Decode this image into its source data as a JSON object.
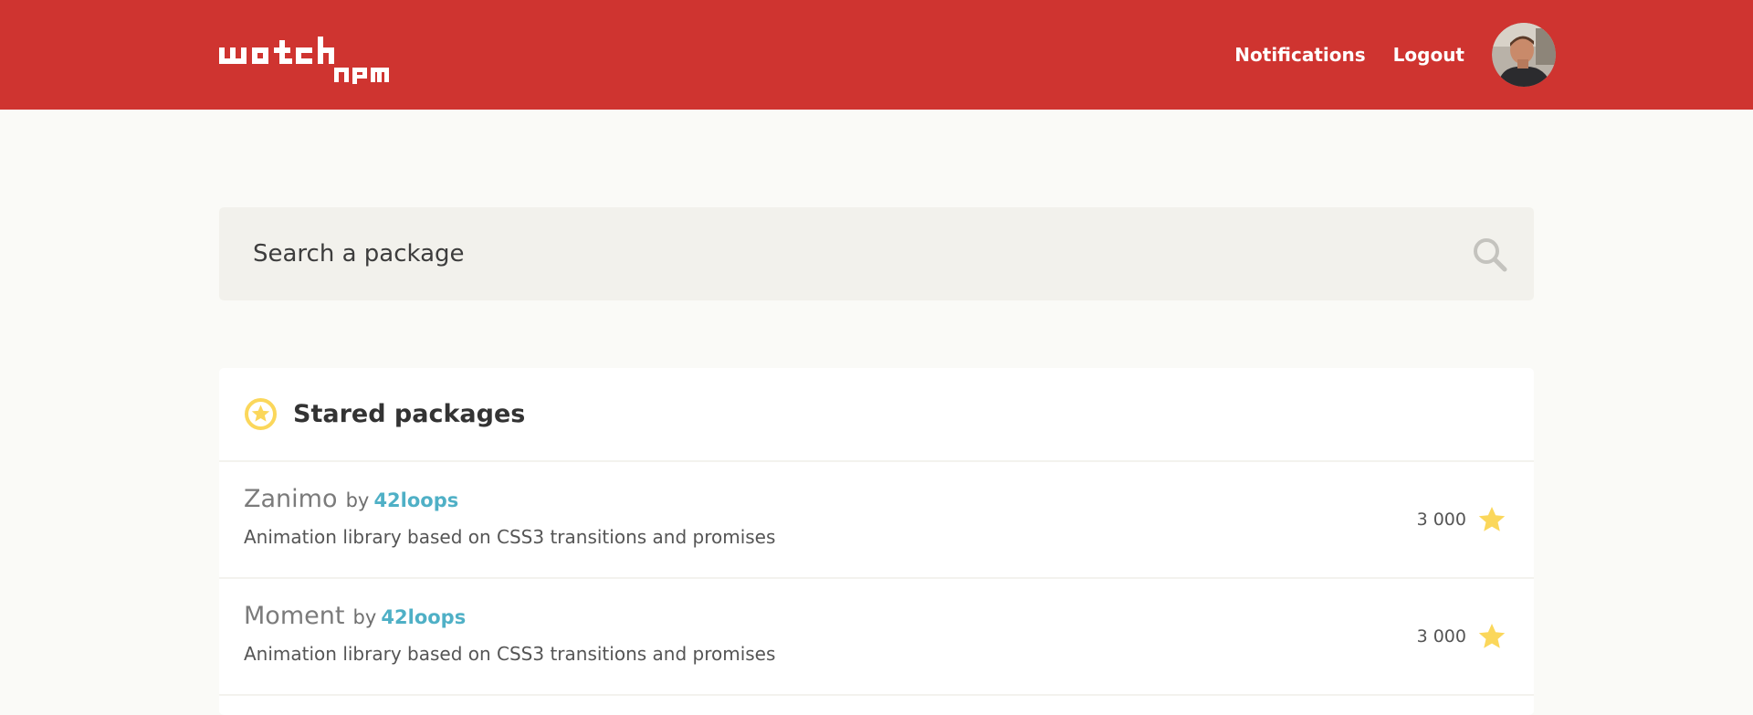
{
  "header": {
    "logo_icon": "watch-npm-logo",
    "nav": {
      "notifications_label": "Notifications",
      "logout_label": "Logout"
    },
    "avatar_icon": "user-avatar"
  },
  "search": {
    "placeholder": "Search a package",
    "icon": "search-icon"
  },
  "stared": {
    "title": "Stared packages",
    "icon": "star-badge-icon",
    "packages": [
      {
        "name": "Zanimo",
        "by": "by",
        "author": "42loops",
        "description": "Animation library based on CSS3 transitions and promises",
        "stars": "3 000"
      },
      {
        "name": "Moment",
        "by": "by",
        "author": "42loops",
        "description": "Animation library based on CSS3 transitions and promises",
        "stars": "3 000"
      }
    ]
  },
  "colors": {
    "header_bg": "#cf3430",
    "page_bg": "#fafaf7",
    "search_bg": "#f2f1ec",
    "accent_link": "#4fb0c6",
    "star": "#fbd75b"
  }
}
